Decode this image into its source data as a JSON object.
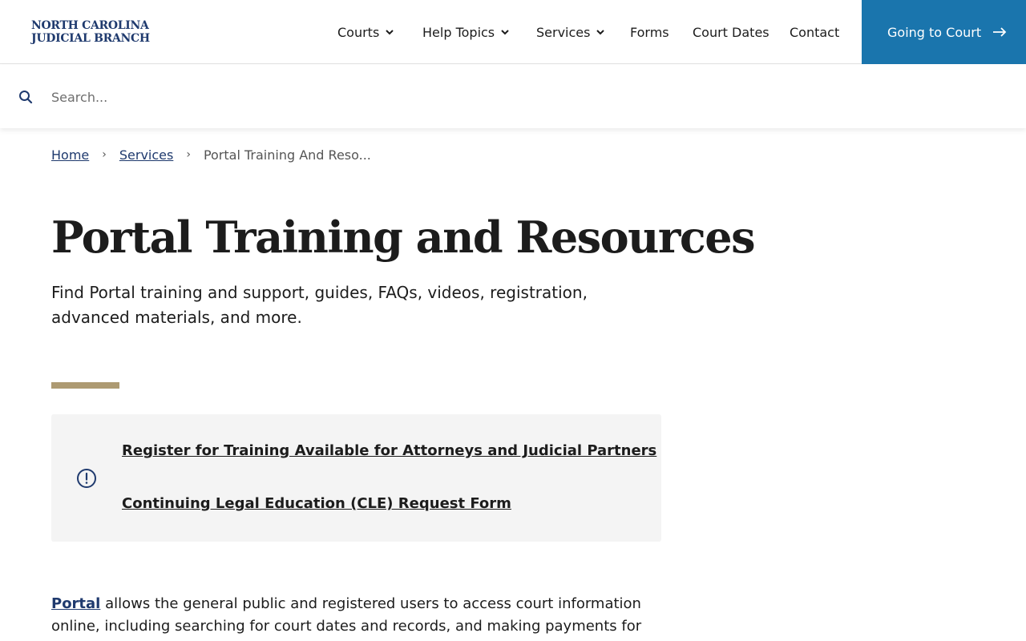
{
  "header": {
    "logo_line1": "NORTH CAROLINA",
    "logo_line2": "JUDICIAL BRANCH",
    "nav": [
      {
        "label": "Courts",
        "dropdown": true
      },
      {
        "label": "Help Topics",
        "dropdown": true
      },
      {
        "label": "Services",
        "dropdown": true
      },
      {
        "label": "Forms",
        "dropdown": false
      },
      {
        "label": "Court Dates",
        "dropdown": false
      },
      {
        "label": "Contact",
        "dropdown": false
      }
    ],
    "cta_label": "Going to Court"
  },
  "search": {
    "placeholder": "Search..."
  },
  "breadcrumb": {
    "home": "Home",
    "services": "Services",
    "current": "Portal Training And Reso..."
  },
  "page": {
    "title": "Portal Training and Resources",
    "lede": "Find Portal training and support, guides, FAQs, videos, registration, advanced materials, and more."
  },
  "alert": {
    "link1": "Register for Training Available for Attorneys and Judicial Partners",
    "link2": "Continuing Legal Education (CLE) Request Form"
  },
  "body": {
    "portal_link": "Portal",
    "text": " allows the general public and registered users to access court information online, including searching for court dates and records, and making payments for"
  },
  "colors": {
    "brand_blue": "#1a75ad",
    "navy": "#1f3a6e",
    "accent_gold": "#ad9a72",
    "alert_bg": "#f4f4f4"
  },
  "icons": {
    "search": "search-icon",
    "alert": "exclamation-circle-icon",
    "chevron": "chevron-down-icon",
    "arrow": "arrow-right-icon"
  }
}
